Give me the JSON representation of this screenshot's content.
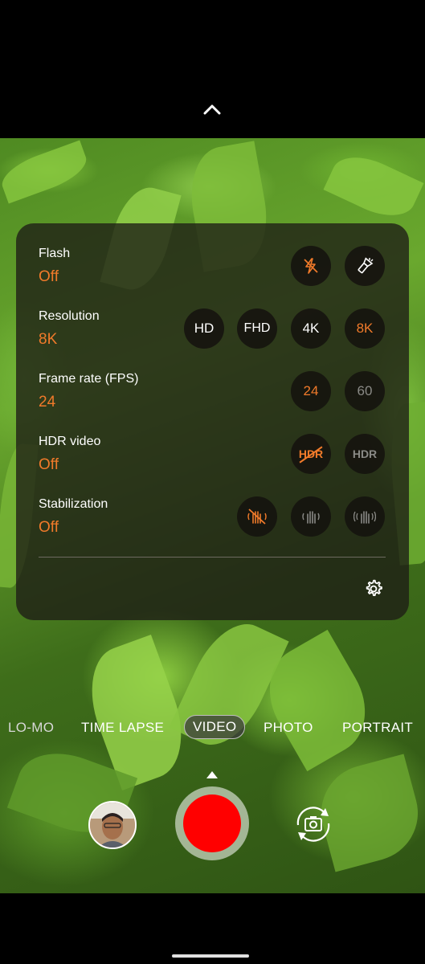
{
  "settings": {
    "flash": {
      "label": "Flash",
      "value": "Off"
    },
    "resolution": {
      "label": "Resolution",
      "value": "8K",
      "options": [
        "HD",
        "FHD",
        "4K",
        "8K"
      ]
    },
    "frame_rate": {
      "label": "Frame rate (FPS)",
      "value": "24",
      "options": [
        "24",
        "60"
      ]
    },
    "hdr": {
      "label": "HDR video",
      "value": "Off",
      "option_on": "HDR",
      "option_off": "HDR"
    },
    "stabilization": {
      "label": "Stabilization",
      "value": "Off"
    }
  },
  "modes": [
    "LO-MO",
    "TIME LAPSE",
    "VIDEO",
    "PHOTO",
    "PORTRAIT"
  ],
  "active_mode": "VIDEO",
  "colors": {
    "accent": "#f07a2a",
    "record": "#ff0000",
    "panel": "#1e1c16"
  },
  "icons": [
    "chevron-up-icon",
    "flash-off-icon",
    "flashlight-icon",
    "hdr-off-icon",
    "stabilization-off-icon",
    "stabilization-on-icon",
    "stabilization-max-icon",
    "gear-icon",
    "chevron-up-caret-icon",
    "camera-flip-icon"
  ]
}
